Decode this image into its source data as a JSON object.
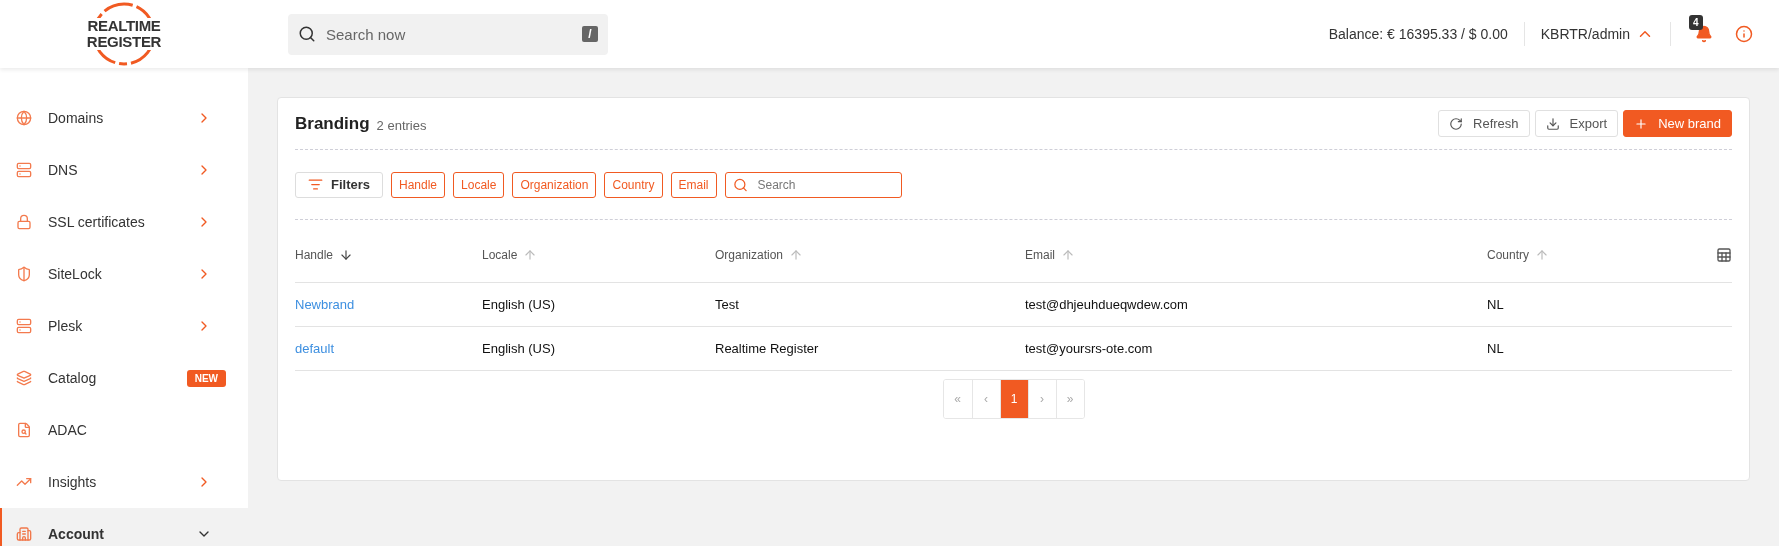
{
  "header": {
    "logo": [
      "REALTIME",
      "REGISTER"
    ],
    "search": {
      "placeholder": "Search now",
      "shortcut": "/"
    },
    "balance": "Balance: € 16395.33 / $ 0.00",
    "account": "KBRTR/admin",
    "notifications": "4"
  },
  "sidebar": {
    "items": [
      {
        "label": "Domains",
        "kind": "submenu",
        "selected": false
      },
      {
        "label": "DNS",
        "kind": "submenu",
        "selected": false
      },
      {
        "label": "SSL certificates",
        "kind": "submenu",
        "selected": false
      },
      {
        "label": "SiteLock",
        "kind": "submenu",
        "selected": false
      },
      {
        "label": "Plesk",
        "kind": "submenu",
        "selected": false
      },
      {
        "label": "Catalog",
        "kind": "plain",
        "badge": "NEW",
        "selected": false
      },
      {
        "label": "ADAC",
        "kind": "plain",
        "selected": false
      },
      {
        "label": "Insights",
        "kind": "submenu",
        "selected": false
      },
      {
        "label": "Account",
        "kind": "group",
        "selected": true
      }
    ]
  },
  "card": {
    "title": "Branding",
    "count": "2 entries",
    "actions": [
      {
        "label": "Refresh",
        "kind": "refresh",
        "primary": false
      },
      {
        "label": "Export",
        "kind": "export",
        "primary": false
      },
      {
        "label": "New brand",
        "kind": "add",
        "primary": true
      }
    ],
    "filters_button": "Filters",
    "filter_chips": [
      "Handle",
      "Locale",
      "Organization",
      "Country",
      "Email"
    ],
    "search": {
      "placeholder": "Search"
    }
  },
  "table": {
    "columns": [
      {
        "label": "Handle",
        "sorted": true
      },
      {
        "label": "Locale",
        "sorted": false
      },
      {
        "label": "Organization",
        "sorted": false
      },
      {
        "label": "Email",
        "sorted": false
      },
      {
        "label": "Country",
        "sorted": false
      }
    ],
    "rows": [
      [
        "Newbrand",
        "English (US)",
        "Test",
        "test@dhjeuhdueqwdew.com",
        "NL"
      ],
      [
        "default",
        "English (US)",
        "Realtime Register",
        "test@yoursrs-ote.com",
        "NL"
      ]
    ]
  },
  "pagination": [
    {
      "label": "«",
      "selected": false
    },
    {
      "label": "‹",
      "selected": false
    },
    {
      "label": "1",
      "selected": true
    },
    {
      "label": "›",
      "selected": false
    },
    {
      "label": "»",
      "selected": false
    }
  ]
}
